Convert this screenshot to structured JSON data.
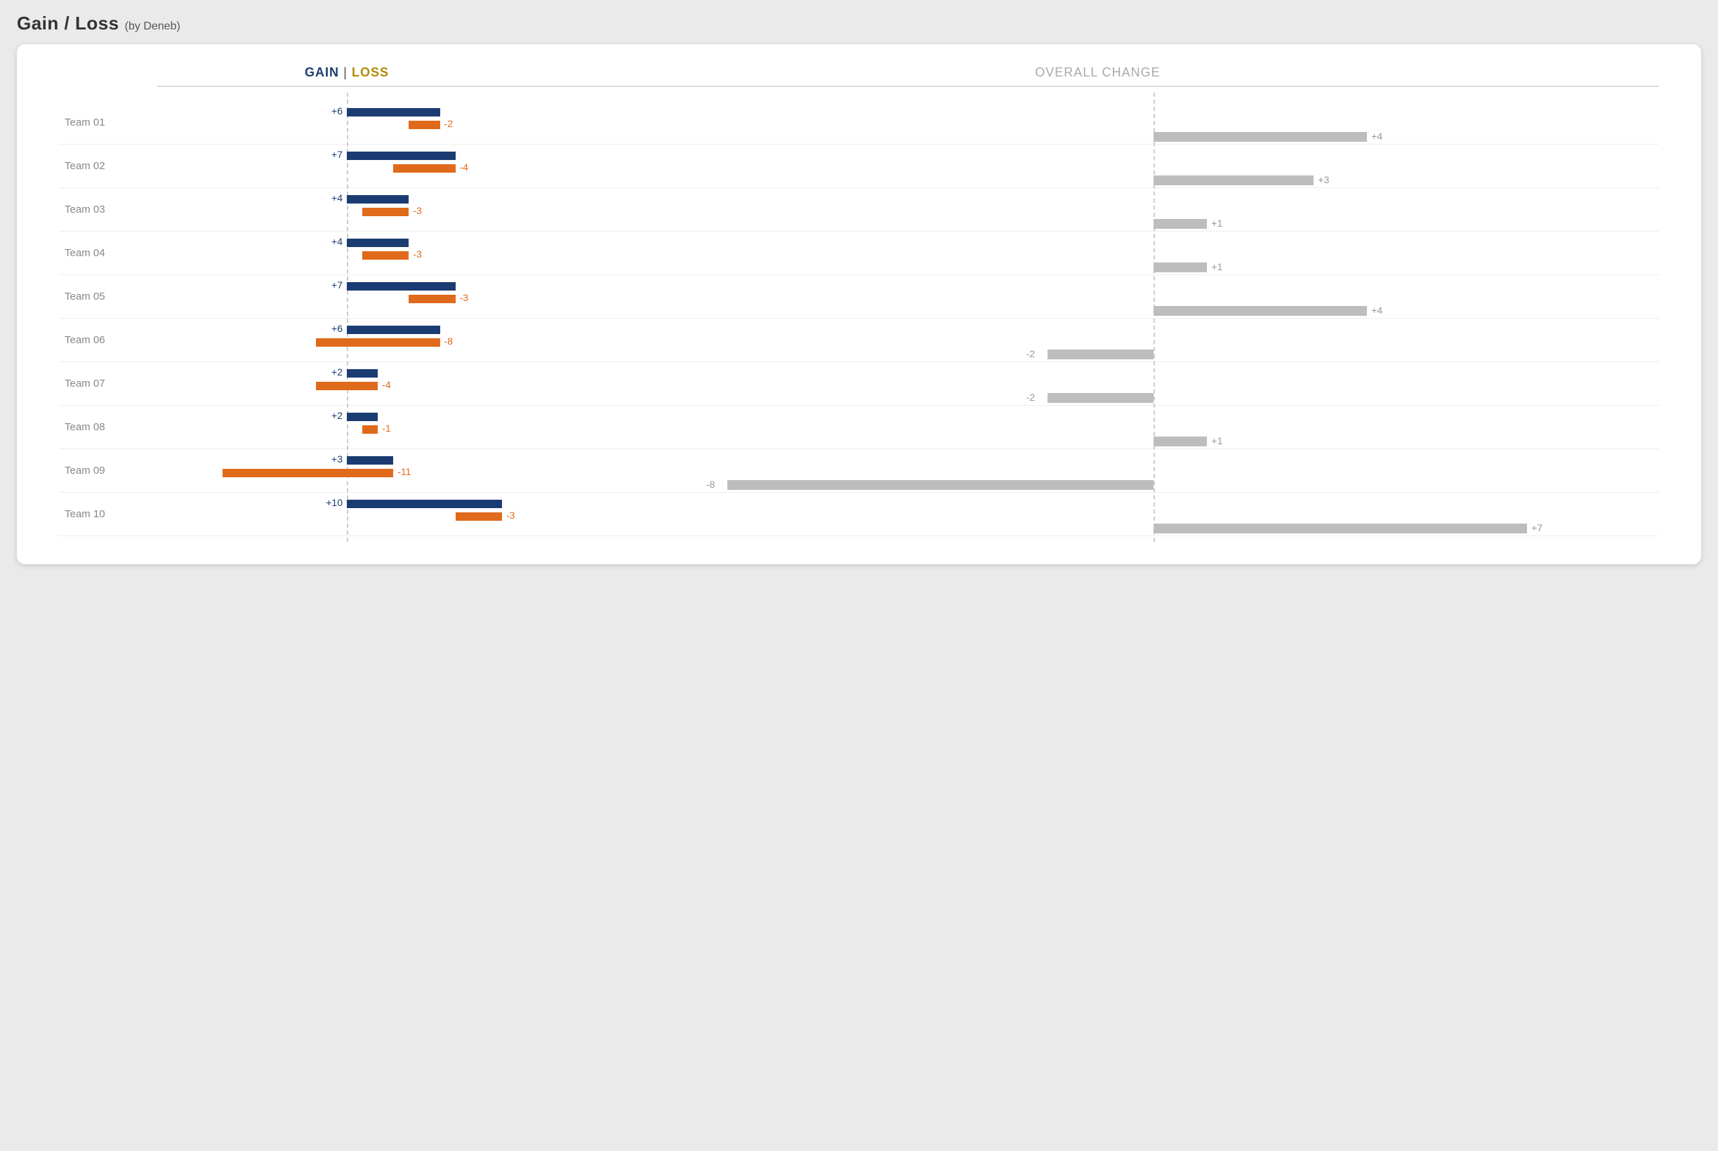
{
  "title": "Gain / Loss",
  "subtitle": "(by Deneb)",
  "header_gain": "GAIN",
  "header_sep": "|",
  "header_loss": "LOSS",
  "header_overall": "OVERALL CHANGE",
  "chart_data": {
    "type": "bar",
    "title": "Gain / Loss (by Deneb)",
    "categories": [
      "Team 01",
      "Team 02",
      "Team 03",
      "Team 04",
      "Team 05",
      "Team 06",
      "Team 07",
      "Team 08",
      "Team 09",
      "Team 10"
    ],
    "series": [
      {
        "name": "Gain",
        "values": [
          6,
          7,
          4,
          4,
          7,
          6,
          2,
          2,
          3,
          10
        ]
      },
      {
        "name": "Loss",
        "values": [
          -2,
          -4,
          -3,
          -3,
          -3,
          -8,
          -4,
          -1,
          -11,
          -3
        ]
      },
      {
        "name": "Change",
        "values": [
          4,
          3,
          1,
          1,
          4,
          -2,
          -2,
          1,
          -8,
          7
        ]
      }
    ],
    "gain_loss_axis_zero": true,
    "change_axis_zero": true,
    "notes": "Gain (navy) and Loss (orange) are drawn from a common zero axis, offset vertically. Overall Change (grey) is a separate diverging bar per team."
  },
  "colors": {
    "gain": "#1b3c72",
    "loss": "#e06a1b",
    "change": "#bdbdbd"
  }
}
